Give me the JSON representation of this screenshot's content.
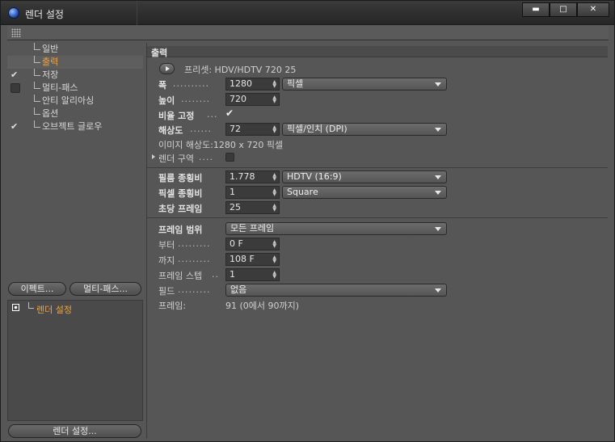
{
  "window": {
    "title": "렌더 설정",
    "controls": [
      "▬",
      "□",
      "✕"
    ]
  },
  "sidebar": {
    "items": [
      {
        "label": "일반",
        "checked": null,
        "active": false
      },
      {
        "label": "출력",
        "checked": null,
        "active": true
      },
      {
        "label": "저장",
        "checked": true,
        "active": false
      },
      {
        "label": "멀티-패스",
        "checked": false,
        "active": false
      },
      {
        "label": "안티 알리아싱",
        "checked": null,
        "active": false
      },
      {
        "label": "옵션",
        "checked": null,
        "active": false
      },
      {
        "label": "오브젝트 글로우",
        "checked": true,
        "active": false
      }
    ],
    "effects_button": "이펙트...",
    "multipass_button": "멀티-패스...",
    "render_settings_item": "렌더 설정",
    "render_settings_button": "렌더 설정..."
  },
  "output": {
    "section_title": "출력",
    "preset_label": "프리셋: HDV/HDTV 720 25",
    "width": {
      "label": "폭",
      "value": "1280",
      "unit": "픽셀"
    },
    "height": {
      "label": "높이",
      "value": "720"
    },
    "lock_ratio": {
      "label": "비율 고정",
      "checked": true
    },
    "resolution": {
      "label": "해상도",
      "value": "72",
      "unit": "픽셀/인치 (DPI)"
    },
    "image_resolution": "이미지 해상도:1280 x 720 픽셀",
    "render_region": {
      "label": "렌더 구역",
      "checked": false
    },
    "film_aspect": {
      "label": "필름 종횡비",
      "value": "1.778",
      "preset": "HDTV (16:9)"
    },
    "pixel_aspect": {
      "label": "픽셀 종횡비",
      "value": "1",
      "preset": "Square"
    },
    "fps": {
      "label": "초당 프레임",
      "value": "25"
    },
    "frame_range": {
      "label": "프레임 범위",
      "value": "모든 프레임"
    },
    "from": {
      "label": "부터",
      "value": "0 F"
    },
    "to": {
      "label": "까지",
      "value": "108 F"
    },
    "frame_step": {
      "label": "프레임 스텝",
      "value": "1"
    },
    "field": {
      "label": "필드",
      "value": "없음"
    },
    "frames": {
      "label": "프레임:",
      "value": "91 (0에서 90까지)"
    }
  }
}
